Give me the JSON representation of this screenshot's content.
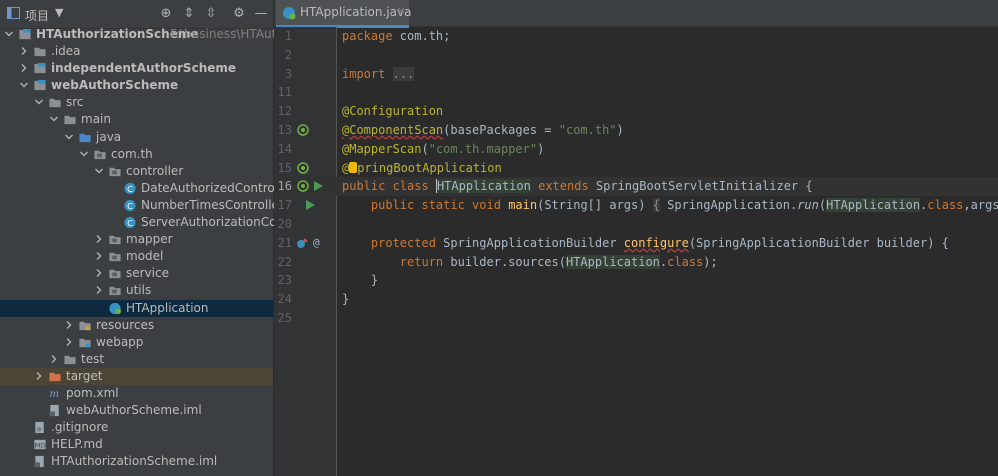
{
  "project_panel": {
    "title": "项目",
    "tree": [
      {
        "label": "HTAuthorizationScheme",
        "path": "F:\\business\\HTAuthori",
        "bold": true,
        "depth": 0,
        "arrow": "down",
        "icon": "module"
      },
      {
        "label": ".idea",
        "depth": 1,
        "arrow": "right",
        "icon": "folder"
      },
      {
        "label": "independentAuthorScheme",
        "bold": true,
        "depth": 1,
        "arrow": "right",
        "icon": "module"
      },
      {
        "label": "webAuthorScheme",
        "bold": true,
        "depth": 1,
        "arrow": "down",
        "icon": "module"
      },
      {
        "label": "src",
        "depth": 2,
        "arrow": "down",
        "icon": "folder"
      },
      {
        "label": "main",
        "depth": 3,
        "arrow": "down",
        "icon": "folder"
      },
      {
        "label": "java",
        "depth": 4,
        "arrow": "down",
        "icon": "folder-src"
      },
      {
        "label": "com.th",
        "depth": 5,
        "arrow": "down",
        "icon": "package"
      },
      {
        "label": "controller",
        "depth": 6,
        "arrow": "down",
        "icon": "package"
      },
      {
        "label": "DateAuthorizedController",
        "depth": 7,
        "icon": "class"
      },
      {
        "label": "NumberTimesController",
        "depth": 7,
        "icon": "class"
      },
      {
        "label": "ServerAuthorizationContro",
        "depth": 7,
        "icon": "class"
      },
      {
        "label": "mapper",
        "depth": 6,
        "arrow": "right",
        "icon": "package"
      },
      {
        "label": "model",
        "depth": 6,
        "arrow": "right",
        "icon": "package"
      },
      {
        "label": "service",
        "depth": 6,
        "arrow": "right",
        "icon": "package"
      },
      {
        "label": "utils",
        "depth": 6,
        "arrow": "right",
        "icon": "package"
      },
      {
        "label": "HTApplication",
        "depth": 6,
        "icon": "spring-class",
        "selected": true
      },
      {
        "label": "resources",
        "depth": 4,
        "arrow": "right",
        "icon": "folder-res"
      },
      {
        "label": "webapp",
        "depth": 4,
        "arrow": "right",
        "icon": "folder-web"
      },
      {
        "label": "test",
        "depth": 3,
        "arrow": "right",
        "icon": "folder"
      },
      {
        "label": "target",
        "depth": 2,
        "arrow": "right",
        "icon": "folder-orange",
        "target": true
      },
      {
        "label": "pom.xml",
        "depth": 2,
        "icon": "maven"
      },
      {
        "label": "webAuthorScheme.iml",
        "depth": 2,
        "icon": "iml"
      },
      {
        "label": ".gitignore",
        "depth": 1,
        "icon": "file"
      },
      {
        "label": "HELP.md",
        "depth": 1,
        "icon": "md"
      },
      {
        "label": "HTAuthorizationScheme.iml",
        "depth": 1,
        "icon": "iml"
      }
    ]
  },
  "editor": {
    "tab_label": "HTApplication.java",
    "tab_close": "×",
    "line_numbers": [
      "1",
      "2",
      "3",
      "11",
      "12",
      "13",
      "14",
      "15",
      "16",
      "17",
      "20",
      "21",
      "22",
      "23",
      "24",
      "25"
    ]
  },
  "colors": {
    "keyword": "#cc7832",
    "annotation": "#bbb529",
    "string": "#6a8759",
    "method": "#ffc66d",
    "text": "#a9b7c6"
  }
}
